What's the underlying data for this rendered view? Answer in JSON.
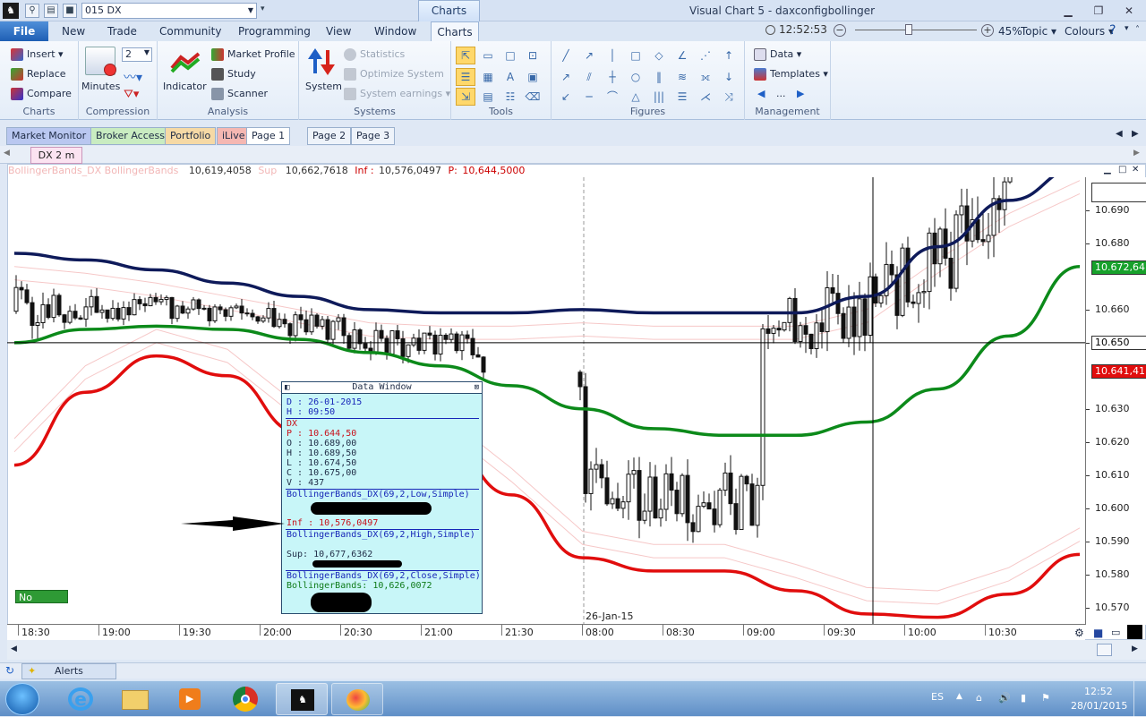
{
  "titlebar": {
    "workspace": "015 DX",
    "context_tab": "Charts",
    "window_title": "Visual Chart 5 - daxconfigbollinger"
  },
  "menu": {
    "file": "File",
    "items": [
      "New",
      "Trade",
      "Community",
      "Programming",
      "View",
      "Window"
    ],
    "active_tab": "Charts",
    "clock": "12:52:53",
    "zoom": "45%",
    "topic": "Topic",
    "colours": "Colours"
  },
  "ribbon": {
    "charts": {
      "insert": "Insert",
      "replace": "Replace",
      "compare": "Compare",
      "label": "Charts"
    },
    "compression": {
      "value": "2",
      "minutes": "Minutes",
      "label": "Compression"
    },
    "analysis": {
      "indicator": "Indicator",
      "market_profile": "Market Profile",
      "study": "Study",
      "scanner": "Scanner",
      "label": "Analysis"
    },
    "systems": {
      "system": "System",
      "statistics": "Statistics",
      "optimize": "Optimize System",
      "earnings": "System earnings",
      "label": "Systems"
    },
    "tools": {
      "label": "Tools"
    },
    "figures": {
      "label": "Figures"
    },
    "management": {
      "data": "Data",
      "templates": "Templates",
      "more": "...",
      "label": "Management"
    }
  },
  "page_tabs": [
    "Market Monitor",
    "Broker Access",
    "Portfolio",
    "iLive",
    "Page 1",
    "Page 2",
    "Page 3"
  ],
  "doc_tab": "DX 2 m",
  "chart_info": {
    "name": "BollingerBands_DX BollingerBands",
    "value": "10,619,4058",
    "sup_label": "Sup",
    "sup": "10,662,7618",
    "inf_label": "Inf :",
    "inf": "10,576,0497",
    "p_label": "P:",
    "p": "10,644,5000"
  },
  "no_orders": "No Orders",
  "date_label": "26-Jan-15",
  "data_window": {
    "title": "Data Window",
    "d": "D  : 26-01-2015",
    "h": "H  : 09:50",
    "symbol": "DX",
    "p": "P  : 10.644,50",
    "o": "O  : 10.689,00",
    "hi": "H  : 10.689,50",
    "l": "L  : 10.674,50",
    "c": "C  : 10.675,00",
    "v": "V  : 437",
    "bb_low": "BollingerBands_DX(69,2,Low,Simple)",
    "inf": "Inf : 10,576,0497",
    "bb_high": "BollingerBands_DX(69,2,High,Simple)",
    "sup": "Sup: 10,677,6362",
    "bb_close": "BollingerBands_DX(69,2,Close,Simple)",
    "bb": "BollingerBands: 10,626,0072"
  },
  "alerts": "Alerts",
  "tray": {
    "lang": "ES",
    "time": "12:52",
    "date": "28/01/2015"
  },
  "chart_data": {
    "type": "candlestick",
    "price_ticks": [
      "10.690",
      "10.680",
      "10.660",
      "10.650",
      "10.630",
      "10.620",
      "10.610",
      "10.600",
      "10.590",
      "10.580",
      "10.570"
    ],
    "time_ticks": [
      "18:30",
      "19:00",
      "19:30",
      "20:00",
      "20:30",
      "21:00",
      "21:30",
      "08:00",
      "08:30",
      "09:00",
      "09:30",
      "10:00",
      "10:30"
    ],
    "price_tags": {
      "upper": "10.672,64",
      "crosshair": "10.650",
      "lower": "10.641,41"
    },
    "ylim": [
      10.565,
      10.7
    ],
    "colors": {
      "upper_band": "#0e1a5a",
      "middle_band": "#0c8a1a",
      "lower_band": "#e10d0d",
      "crosshair": "#000000"
    },
    "series": [
      {
        "name": "Sup",
        "values": [
          10.677,
          10.675,
          10.672,
          10.668,
          10.664,
          10.66,
          10.659,
          10.659,
          10.66,
          10.659,
          10.659,
          10.659,
          10.664,
          10.679,
          10.693,
          10.703
        ]
      },
      {
        "name": "BollingerBands",
        "values": [
          10.65,
          10.654,
          10.655,
          10.654,
          10.651,
          10.647,
          10.643,
          10.637,
          10.63,
          10.624,
          10.622,
          10.622,
          10.626,
          10.636,
          10.652,
          10.673
        ]
      },
      {
        "name": "Inf",
        "values": [
          10.613,
          10.635,
          10.646,
          10.64,
          10.623,
          10.621,
          10.621,
          10.604,
          10.585,
          10.581,
          10.581,
          10.575,
          10.568,
          10.567,
          10.574,
          10.586
        ]
      }
    ]
  }
}
